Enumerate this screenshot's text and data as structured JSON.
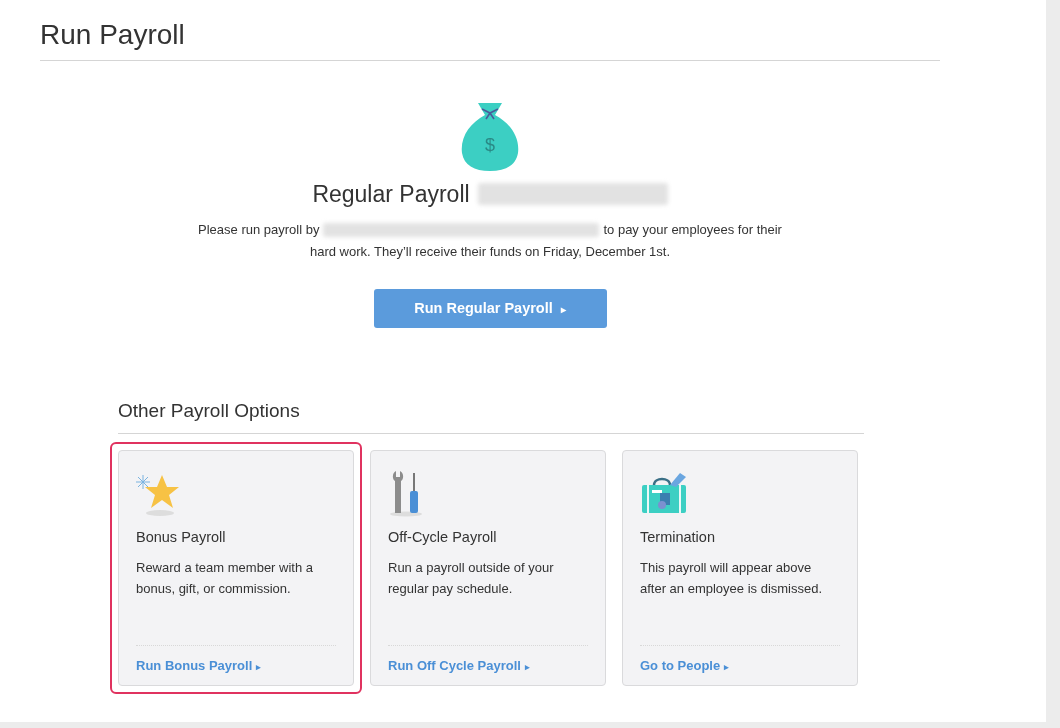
{
  "page_title": "Run Payroll",
  "regular": {
    "icon_symbol": "$",
    "title": "Regular Payroll",
    "title_redacted": true,
    "message_before": "Please run payroll by",
    "message_after": "to pay your employees for their",
    "message_line2": "hard work. They’ll receive their funds on Friday, December 1st.",
    "button": {
      "label": "Run Regular Payroll",
      "arrow": "▸"
    }
  },
  "other_options": {
    "heading": "Other Payroll Options",
    "cards": [
      {
        "kind": "star",
        "title": "Bonus Payroll",
        "description": "Reward a team member with a bonus, gift, or commission.",
        "link": "Run Bonus Payroll",
        "arrow": "▸",
        "highlighted": true
      },
      {
        "kind": "tools",
        "title": "Off-Cycle Payroll",
        "description": "Run a payroll outside of your regular pay schedule.",
        "link": "Run Off Cycle Payroll",
        "arrow": "▸",
        "highlighted": false
      },
      {
        "kind": "luggage",
        "title": "Termination",
        "description": "This payroll will appear above after an employee is dismissed.",
        "link": "Go to People",
        "arrow": "▸",
        "highlighted": false
      }
    ]
  }
}
